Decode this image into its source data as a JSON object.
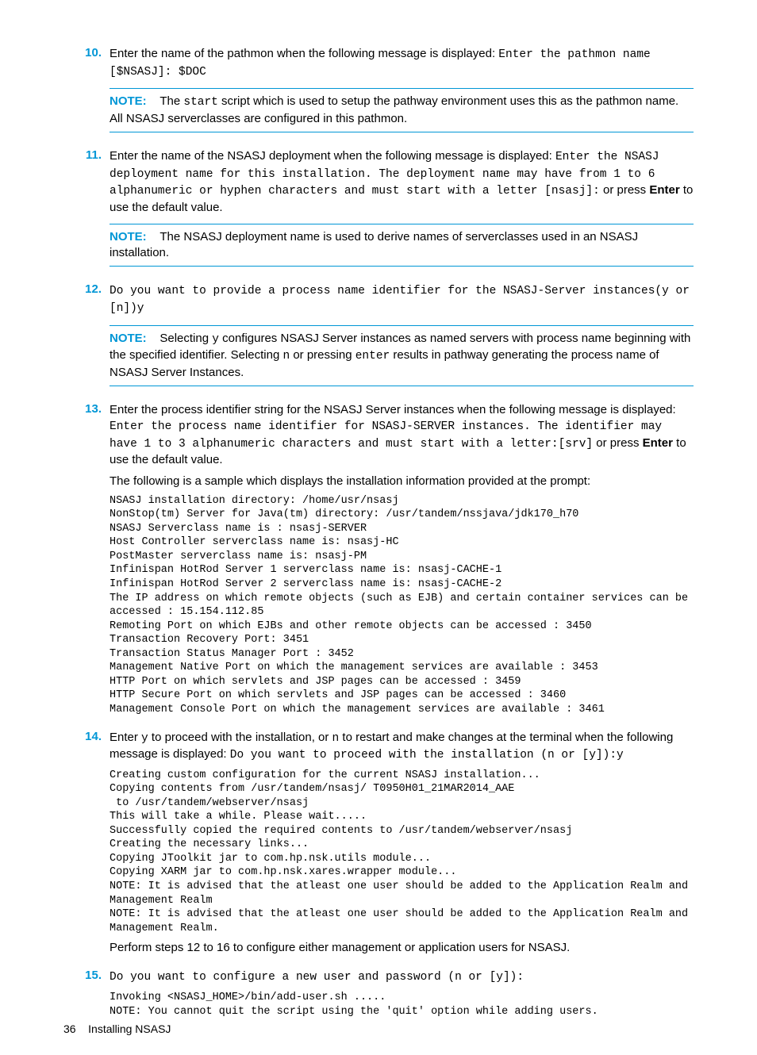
{
  "items": {
    "n10": {
      "num": "10.",
      "text1": "Enter the name of the pathmon when the following message is displayed: ",
      "code1": "Enter the pathmon name [$NSASJ]: $DOC",
      "noteLabel": "NOTE:",
      "noteText1": "The ",
      "noteCode": "start",
      "noteText2": " script which is used to setup the pathway environment uses this as the pathmon name. All NSASJ serverclasses are configured in this pathmon."
    },
    "n11": {
      "num": "11.",
      "text1": "Enter the name of the NSASJ deployment when the following message is displayed: ",
      "code1": "Enter the NSASJ deployment name for this installation. The deployment name may have from 1 to 6 alphanumeric or hyphen characters and must start with a letter [nsasj]:",
      "text2": " or press ",
      "bold1": "Enter",
      "text3": " to use the default value.",
      "noteLabel": "NOTE:",
      "noteText": "The NSASJ deployment name is used to derive names of serverclasses used in an NSASJ installation."
    },
    "n12": {
      "num": "12.",
      "code1": "Do you want to provide a process name identifier for the NSASJ-Server instances(y or [n])y",
      "noteLabel": "NOTE:",
      "noteText1": "Selecting ",
      "noteCode1": "y",
      "noteText2": " configures NSASJ Server instances as named servers with process name beginning with the specified identifier. Selecting ",
      "noteCode2": "n",
      "noteText3": " or pressing ",
      "noteCode3": "enter",
      "noteText4": " results in pathway generating the process name of NSASJ Server Instances."
    },
    "n13": {
      "num": "13.",
      "text1": "Enter the process identifier string for the NSASJ Server instances when the following message is displayed: ",
      "code1": "Enter the process name identifier for NSASJ-SERVER instances. The identifier may have 1 to 3 alphanumeric characters and must start with a letter:[srv]",
      "text2": " or press ",
      "bold1": "Enter",
      "text3": " to use the default value.",
      "intro": "The following is a sample which displays the installation information provided at the prompt:",
      "codeBlock": "NSASJ installation directory: /home/usr/nsasj\nNonStop(tm) Server for Java(tm) directory: /usr/tandem/nssjava/jdk170_h70\nNSASJ Serverclass name is : nsasj-SERVER\nHost Controller serverclass name is: nsasj-HC\nPostMaster serverclass name is: nsasj-PM\nInfinispan HotRod Server 1 serverclass name is: nsasj-CACHE-1\nInfinispan HotRod Server 2 serverclass name is: nsasj-CACHE-2\nThe IP address on which remote objects (such as EJB) and certain container services can be accessed : 15.154.112.85\nRemoting Port on which EJBs and other remote objects can be accessed : 3450\nTransaction Recovery Port: 3451\nTransaction Status Manager Port : 3452\nManagement Native Port on which the management services are available : 3453\nHTTP Port on which servlets and JSP pages can be accessed : 3459\nHTTP Secure Port on which servlets and JSP pages can be accessed : 3460\nManagement Console Port on which the management services are available : 3461"
    },
    "n14": {
      "num": "14.",
      "text1": "Enter ",
      "code1": "y",
      "text2": " to proceed with the installation, or ",
      "code2": "n",
      "text3": " to restart and make changes at the terminal when the following message is displayed: ",
      "code3": "Do you want to proceed with the installation (n or [y]):y",
      "codeBlock": "Creating custom configuration for the current NSASJ installation...\nCopying contents from /usr/tandem/nsasj/ T0950H01_21MAR2014_AAE\n to /usr/tandem/webserver/nsasj\nThis will take a while. Please wait.....\nSuccessfully copied the required contents to /usr/tandem/webserver/nsasj\nCreating the necessary links...\nCopying JToolkit jar to com.hp.nsk.utils module...\nCopying XARM jar to com.hp.nsk.xares.wrapper module...\nNOTE: It is advised that the atleast one user should be added to the Application Realm and Management Realm\nNOTE: It is advised that the atleast one user should be added to the Application Realm and Management Realm.",
      "post": "Perform steps 12 to 16 to configure either management or application users for NSASJ."
    },
    "n15": {
      "num": "15.",
      "code1": "Do you want to configure a new user and password (n or [y]):",
      "codeBlock": "Invoking <NSASJ_HOME>/bin/add-user.sh .....\nNOTE: You cannot quit the script using the 'quit' option while adding users."
    }
  },
  "footer": {
    "page": "36",
    "title": "Installing NSASJ"
  }
}
